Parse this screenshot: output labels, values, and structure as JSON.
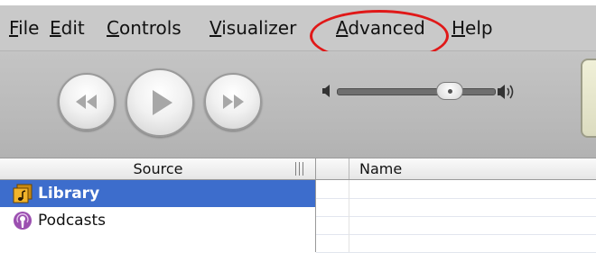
{
  "menu": {
    "items": [
      {
        "label": "File",
        "mnemonic": "F",
        "rest": "ile"
      },
      {
        "label": "Edit",
        "mnemonic": "E",
        "rest": "dit"
      },
      {
        "label": "Controls",
        "mnemonic": "C",
        "rest": "ontrols"
      },
      {
        "label": "Visualizer",
        "mnemonic": "V",
        "rest": "isualizer"
      },
      {
        "label": "Advanced",
        "mnemonic": "A",
        "rest": "dvanced"
      },
      {
        "label": "Help",
        "mnemonic": "H",
        "rest": "elp"
      }
    ],
    "highlighted": "Advanced",
    "highlight_color": "#e01818"
  },
  "toolbar": {
    "buttons": [
      "previous-track",
      "play",
      "next-track"
    ],
    "volume_level": 0.72
  },
  "columns": {
    "source_header": "Source",
    "name_header": "Name"
  },
  "sources": [
    {
      "label": "Library",
      "icon": "library-music-icon",
      "selected": true
    },
    {
      "label": "Podcasts",
      "icon": "podcast-icon",
      "selected": false
    }
  ],
  "colors": {
    "selection": "#3d6dcc",
    "chrome": "#c0c0c0"
  }
}
